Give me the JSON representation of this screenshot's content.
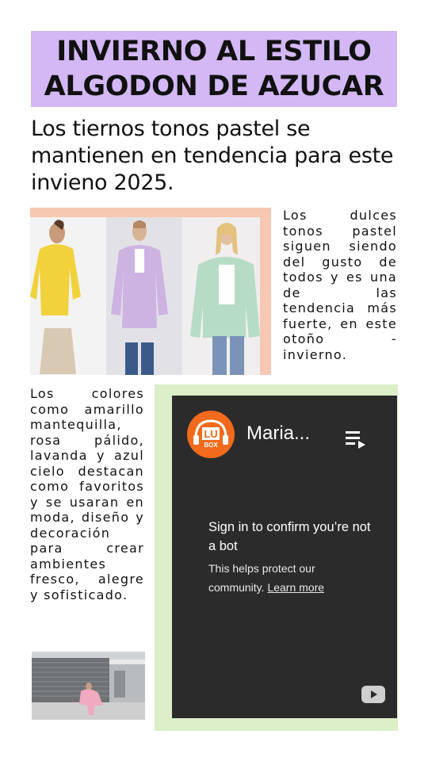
{
  "header": {
    "title_line1": "INVIERNO AL ESTILO",
    "title_line2": "ALGODON DE AZUCAR",
    "background_color": "#d3b8f5"
  },
  "subtitle": "Los tiernos tonos pastel se mantienen en tendencia para este invieno 2025.",
  "paragraph_1": "Los dulces tonos pastel siguen siendo del gusto de todos y es una de las tendencia más fuerte, en este otoño - invierno.",
  "paragraph_2": "Los colores como amarillo mantequilla, rosa pálido, lavanda y azul cielo destacan como favoritos y se usaran en moda, diseño y decoración para crear ambientes fresco, alegre y sofisticado.",
  "video_embed": {
    "channel_logo_text": "LU",
    "channel_logo_subtext": "BOX",
    "title": "Maria...",
    "signin_title": "Sign in to confirm you’re not a bot",
    "signin_desc": "This helps protect our community.",
    "learn_more": "Learn more",
    "colors": {
      "background": "#2b2b2b",
      "logo": "#f26a1b",
      "frame": "#dcefc8"
    }
  },
  "icons": [
    "playlist-icon",
    "youtube-icon",
    "channel-logo-icon"
  ]
}
